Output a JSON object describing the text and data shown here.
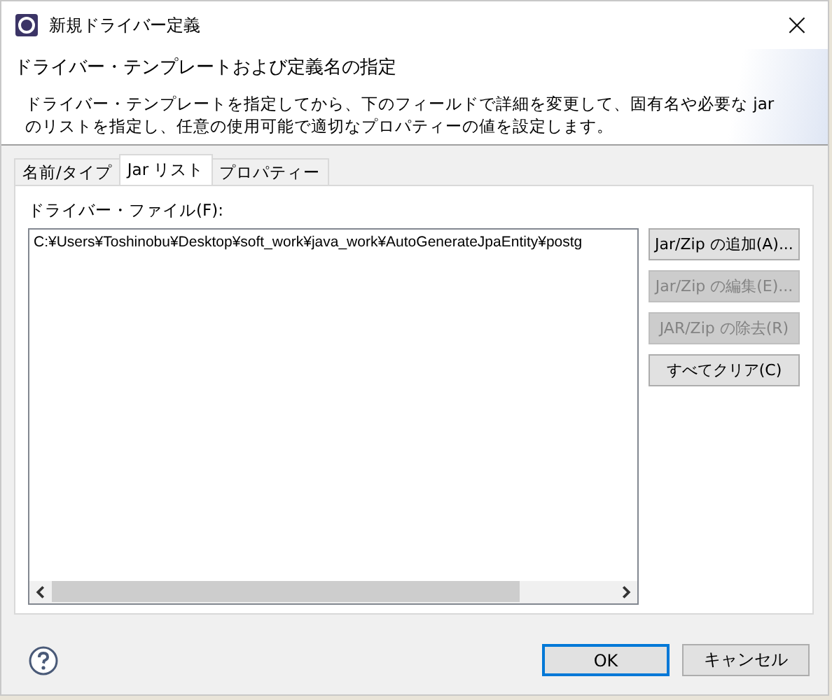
{
  "window": {
    "title": "新規ドライバー定義",
    "close": "×"
  },
  "header": {
    "title": "ドライバー・テンプレートおよび定義名の指定",
    "description": "ドライバー・テンプレートを指定してから、下のフィールドで詳細を変更して、固有名や必要な jar のリストを指定し、任意の使用可能で適切なプロパティーの値を設定します。"
  },
  "tabs": [
    {
      "label": "名前/タイプ",
      "selected": false
    },
    {
      "label": "Jar リスト",
      "selected": true
    },
    {
      "label": "プロパティー",
      "selected": false
    }
  ],
  "driver_files": {
    "label": "ドライバー・ファイル(F):",
    "items": [
      "C:¥Users¥Toshinobu¥Desktop¥soft_work¥java_work¥AutoGenerateJpaEntity¥postg"
    ]
  },
  "side_buttons": [
    {
      "label": "Jar/Zip の追加(A)...",
      "disabled": false
    },
    {
      "label": "Jar/Zip の編集(E)...",
      "disabled": true
    },
    {
      "label": "JAR/Zip の除去(R)",
      "disabled": true
    },
    {
      "label": "すべてクリア(C)",
      "disabled": false
    }
  ],
  "buttons": [
    {
      "label": "OK",
      "default": true
    },
    {
      "label": "キャンセル",
      "default": false
    }
  ]
}
